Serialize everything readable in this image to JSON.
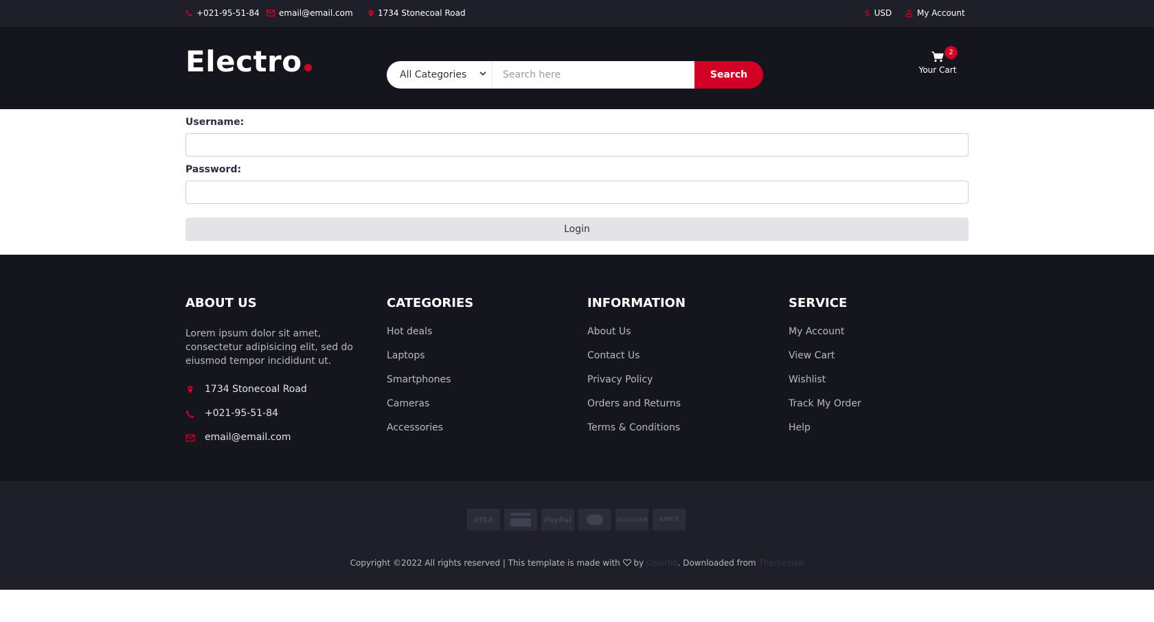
{
  "topbar": {
    "phone": "+021-95-51-84",
    "email": "email@email.com",
    "address": "1734 Stonecoal Road",
    "currency": "USD",
    "account": "My Account"
  },
  "header": {
    "logo": "Electro",
    "category_selected": "All Categories",
    "search_placeholder": "Search here",
    "search_button": "Search",
    "cart_label": "Your Cart",
    "cart_count": "2"
  },
  "form": {
    "username_label": "Username:",
    "password_label": "Password:",
    "login_button": "Login"
  },
  "footer": {
    "about": {
      "title": "ABOUT US",
      "text": "Lorem ipsum dolor sit amet, consectetur adipisicing elit, sed do eiusmod tempor incididunt ut.",
      "address": "1734 Stonecoal Road",
      "phone": "+021-95-51-84",
      "email": "email@email.com"
    },
    "categories": {
      "title": "CATEGORIES",
      "items": [
        "Hot deals",
        "Laptops",
        "Smartphones",
        "Cameras",
        "Accessories"
      ]
    },
    "information": {
      "title": "INFORMATION",
      "items": [
        "About Us",
        "Contact Us",
        "Privacy Policy",
        "Orders and Returns",
        "Terms & Conditions"
      ]
    },
    "service": {
      "title": "SERVICE",
      "items": [
        "My Account",
        "View Cart",
        "Wishlist",
        "Track My Order",
        "Help"
      ]
    }
  },
  "bottom": {
    "payment_cards": [
      "VISA",
      "card",
      "PayPal",
      "mastercard",
      "DISCOVER",
      "AMEX"
    ],
    "copyright_prefix": "Copyright ©2022 All rights reserved | This template is made with",
    "by": "by",
    "colorlib": "Colorlib",
    "downloaded": ". Downloaded from",
    "themeslab": "Themeslab"
  },
  "colors": {
    "accent": "#d10024",
    "dark": "#15161d",
    "topbar": "#1e1f29"
  }
}
